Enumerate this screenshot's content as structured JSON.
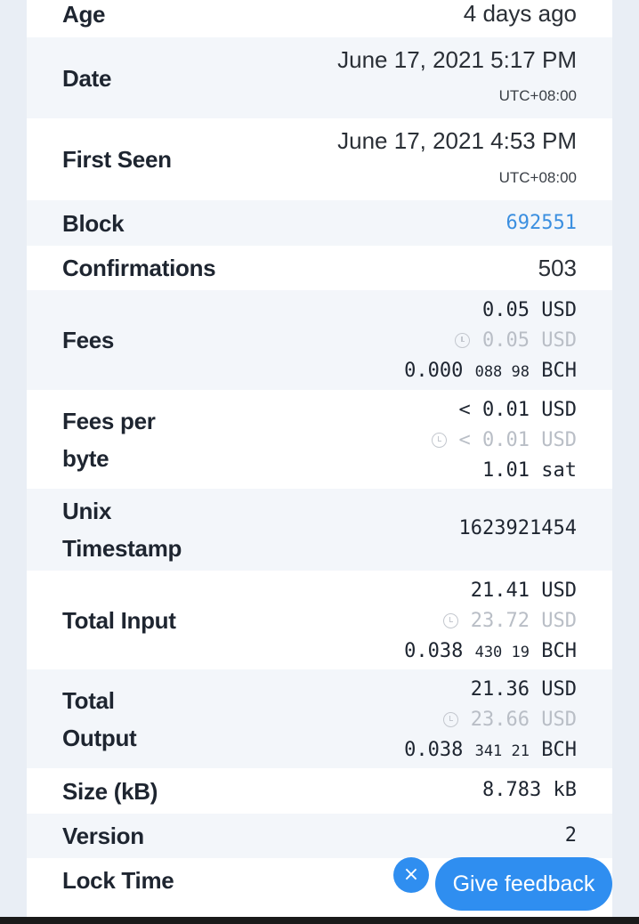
{
  "rows": {
    "age": {
      "label": "Age",
      "value": "4 days ago"
    },
    "date": {
      "label": "Date",
      "value": "June 17, 2021 5:17 PM",
      "tz": "UTC+08:00"
    },
    "first_seen": {
      "label": "First Seen",
      "value": "June 17, 2021 4:53 PM",
      "tz": "UTC+08:00"
    },
    "block": {
      "label": "Block",
      "value": "692551"
    },
    "confirmations": {
      "label": "Confirmations",
      "value": "503"
    },
    "fees": {
      "label": "Fees",
      "usd": "0.05 USD",
      "usd_hist": "0.05 USD",
      "bch_main": "0.000",
      "bch_small": "088 98",
      "bch_unit": "BCH"
    },
    "fees_per_byte": {
      "label_1": "Fees per",
      "label_2": "byte",
      "usd": "< 0.01 USD",
      "usd_hist": "< 0.01 USD",
      "sat": "1.01 sat"
    },
    "unix_timestamp": {
      "label_1": "Unix",
      "label_2": "Timestamp",
      "value": "1623921454"
    },
    "total_input": {
      "label": "Total Input",
      "usd": "21.41 USD",
      "usd_hist": "23.72 USD",
      "bch_main": "0.038",
      "bch_small": "430 19",
      "bch_unit": "BCH"
    },
    "total_output": {
      "label_1": "Total",
      "label_2": "Output",
      "usd": "21.36 USD",
      "usd_hist": "23.66 USD",
      "bch_main": "0.038",
      "bch_small": "341 21",
      "bch_unit": "BCH"
    },
    "size": {
      "label": "Size (kB)",
      "value": "8.783 kB"
    },
    "version": {
      "label": "Version",
      "value": "2"
    },
    "lock_time": {
      "label": "Lock Time"
    }
  },
  "feedback": {
    "close": "×",
    "label": "Give feedback"
  },
  "icons": {
    "history": "clock-icon",
    "close": "close-icon"
  },
  "colors": {
    "link": "#3b8fe0",
    "accent": "#2f8ef0",
    "alt_row": "#f3f6fa"
  }
}
